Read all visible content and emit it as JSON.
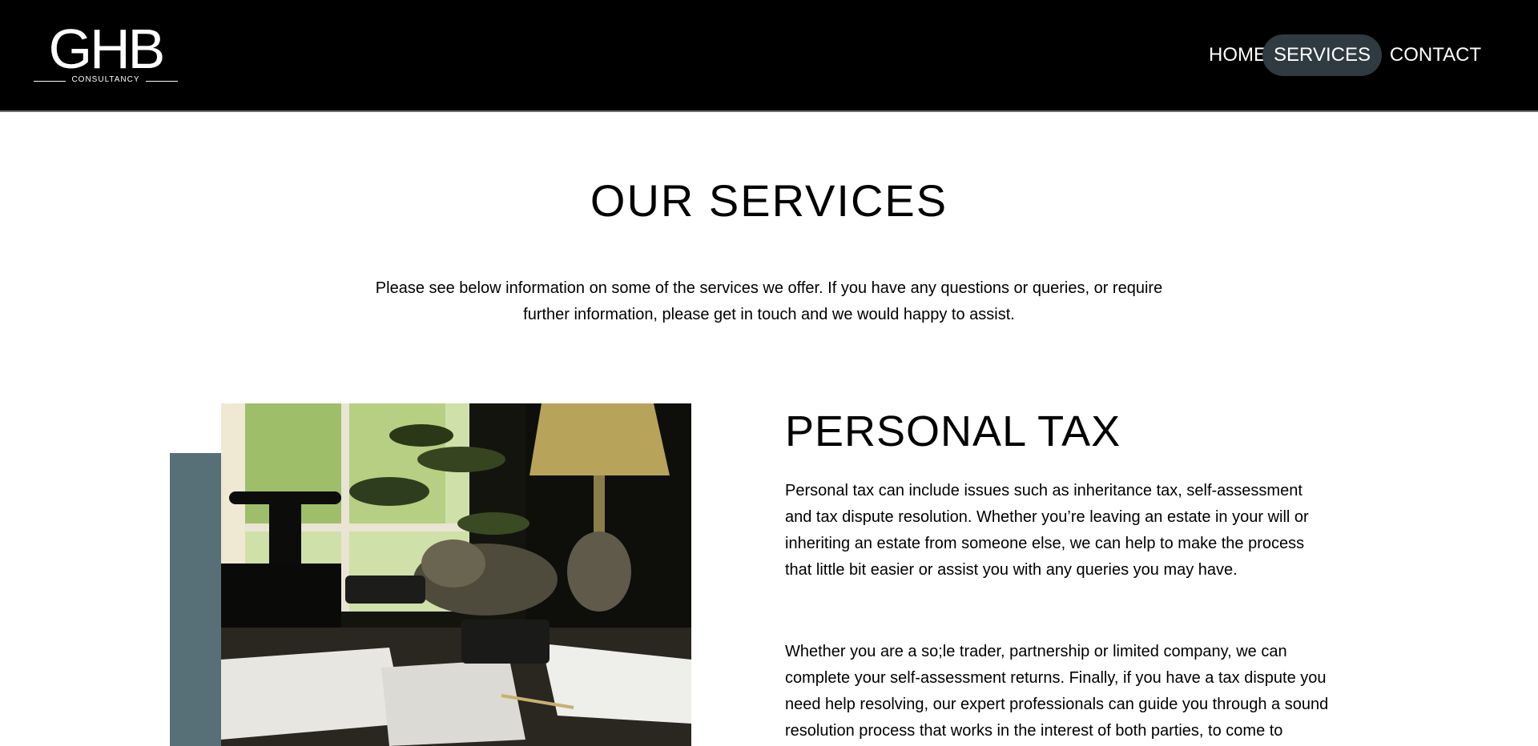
{
  "header": {
    "logo": {
      "letters": "GHB",
      "subtitle": "CONSULTANCY"
    },
    "nav": [
      {
        "label": "HOME"
      },
      {
        "label": "SERVICES"
      },
      {
        "label": "CONTACT"
      }
    ]
  },
  "services": {
    "title": "OUR SERVICES",
    "intro": "Please see below information on some of the services we offer. If you have any questions or queries, or require further information, please get in touch and we would happy to assist."
  },
  "personal_tax": {
    "heading": "PERSONAL TAX",
    "paragraph_1": "Personal tax can include issues such as inheritance tax, self-assessment and tax dispute resolution. Whether you’re leaving an estate in your will or inheriting an estate from someone else, we can help to make the process that little bit easier or assist you with any queries you may have.",
    "paragraph_2": "Whether you are a so;le trader, partnership or limited company, we can complete your self-assessment returns. Finally, if you have a tax dispute you need help resolving, our expert professionals can guide you through a sound resolution process that works in the interest of both parties, to come to"
  },
  "colors": {
    "header_bg": "#000000",
    "nav_active_bg": "#2f3b40",
    "accent_bar": "#577077"
  }
}
